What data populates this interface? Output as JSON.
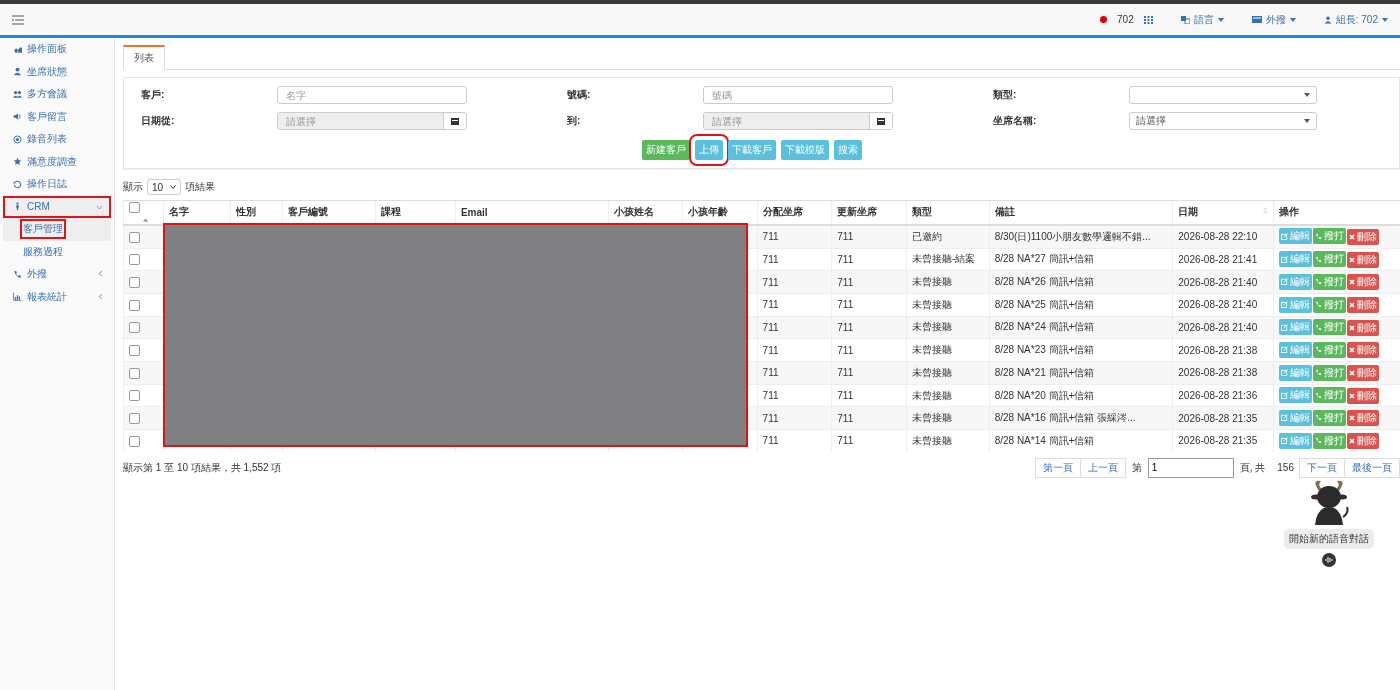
{
  "topbar": {
    "extension": "702",
    "language_menu": "語言",
    "dial_menu": "外撥",
    "user_menu": "組長: 702"
  },
  "sidebar": {
    "items": [
      {
        "label": "操作面板",
        "selected": false,
        "annotated": false
      },
      {
        "label": "坐席狀態",
        "selected": false,
        "annotated": false
      },
      {
        "label": "多方會議",
        "selected": false,
        "annotated": false
      },
      {
        "label": "客戶留言",
        "selected": false,
        "annotated": false
      },
      {
        "label": "錄音列表",
        "selected": false,
        "annotated": false
      },
      {
        "label": "滿意度調查",
        "selected": false,
        "annotated": false
      },
      {
        "label": "操作日誌",
        "selected": false,
        "annotated": false
      },
      {
        "label": "CRM",
        "selected": true,
        "annotated": true,
        "expanded": true,
        "children": [
          {
            "label": "客戶管理",
            "selected": true,
            "annotated": true
          },
          {
            "label": "服務過程",
            "selected": false,
            "annotated": false
          }
        ]
      },
      {
        "label": "外撥",
        "selected": false,
        "annotated": false,
        "expanded": false
      },
      {
        "label": "報表統計",
        "selected": false,
        "annotated": false,
        "expanded": false
      }
    ]
  },
  "tabs": [
    {
      "label": "列表",
      "selected": true
    }
  ],
  "filters": {
    "customer_label": "客戶:",
    "customer_placeholder": "名字",
    "number_label": "號碼:",
    "number_placeholder": "號碼",
    "type_label": "類型:",
    "date_from_label": "日期從:",
    "date_from_placeholder": "請選擇",
    "date_to_label": "到:",
    "date_to_placeholder": "請選擇",
    "seat_label": "坐席名稱:",
    "seat_placeholder": "請選擇"
  },
  "buttons": [
    {
      "label": "新建客戶",
      "kind": "success",
      "annotated": false
    },
    {
      "label": "上傳",
      "kind": "info",
      "annotated": true
    },
    {
      "label": "下載客戶",
      "kind": "info",
      "annotated": false
    },
    {
      "label": "下載模版",
      "kind": "info",
      "annotated": false
    },
    {
      "label": "搜索",
      "kind": "info",
      "annotated": false
    }
  ],
  "page_size": {
    "prefix": "顯示",
    "value": "10",
    "suffix": "項結果"
  },
  "table": {
    "select_all_checked": false,
    "columns": [
      "名字",
      "性別",
      "客戶編號",
      "課程",
      "Email",
      "小孩姓名",
      "小孩年齡",
      "分配坐席",
      "更新坐席",
      "類型",
      "備註",
      "日期",
      "操作"
    ],
    "rows": [
      {
        "checked": false,
        "assigned_seat": "711",
        "updated_seat": "711",
        "type": "已邀約",
        "note": "8/30(日)1100小朋友數學邏輯不錯...",
        "date": "2026-08-28 22:10",
        "actions": [
          "編輯",
          "撥打",
          "刪除"
        ]
      },
      {
        "checked": false,
        "assigned_seat": "711",
        "updated_seat": "711",
        "type": "未曾接聽-結案",
        "note": "8/28 NA*27 簡訊+信箱",
        "date": "2026-08-28 21:41",
        "actions": [
          "編輯",
          "撥打",
          "刪除"
        ]
      },
      {
        "checked": false,
        "assigned_seat": "711",
        "updated_seat": "711",
        "type": "未曾接聽",
        "note": "8/28 NA*26 簡訊+信箱",
        "date": "2026-08-28 21:40",
        "actions": [
          "編輯",
          "撥打",
          "刪除"
        ]
      },
      {
        "checked": false,
        "assigned_seat": "711",
        "updated_seat": "711",
        "type": "未曾接聽",
        "note": "8/28 NA*25 簡訊+信箱",
        "date": "2026-08-28 21:40",
        "actions": [
          "編輯",
          "撥打",
          "刪除"
        ]
      },
      {
        "checked": false,
        "assigned_seat": "711",
        "updated_seat": "711",
        "type": "未曾接聽",
        "note": "8/28 NA*24 簡訊+信箱",
        "date": "2026-08-28 21:40",
        "actions": [
          "編輯",
          "撥打",
          "刪除"
        ]
      },
      {
        "checked": false,
        "assigned_seat": "711",
        "updated_seat": "711",
        "type": "未曾接聽",
        "note": "8/28 NA*23 簡訊+信箱",
        "date": "2026-08-28 21:38",
        "actions": [
          "編輯",
          "撥打",
          "刪除"
        ]
      },
      {
        "checked": false,
        "assigned_seat": "711",
        "updated_seat": "711",
        "type": "未曾接聽",
        "note": "8/28 NA*21 簡訊+信箱",
        "date": "2026-08-28 21:38",
        "actions": [
          "編輯",
          "撥打",
          "刪除"
        ]
      },
      {
        "checked": false,
        "assigned_seat": "711",
        "updated_seat": "711",
        "type": "未曾接聽",
        "note": "8/28 NA*20 簡訊+信箱",
        "date": "2026-08-28 21:36",
        "actions": [
          "編輯",
          "撥打",
          "刪除"
        ]
      },
      {
        "checked": false,
        "assigned_seat": "711",
        "updated_seat": "711",
        "type": "未曾接聽",
        "note": "8/28 NA*16 簡訊+信箱 張綵涔...",
        "date": "2026-08-28 21:35",
        "actions": [
          "編輯",
          "撥打",
          "刪除"
        ]
      },
      {
        "checked": false,
        "assigned_seat": "711",
        "updated_seat": "711",
        "type": "未曾接聽",
        "note": "8/28 NA*14 簡訊+信箱",
        "date": "2026-08-28 21:35",
        "actions": [
          "編輯",
          "撥打",
          "刪除"
        ]
      }
    ]
  },
  "footer": {
    "summary": "顯示第 1 至 10 項結果，共 1,552 項",
    "first": "第一頁",
    "prev": "上一頁",
    "page_prefix": "第",
    "page_value": "1",
    "page_suffix": "頁, 共",
    "page_total": "156",
    "next": "下一頁",
    "last": "最後一頁"
  },
  "assistant": {
    "label": "開始新的語音對話"
  }
}
